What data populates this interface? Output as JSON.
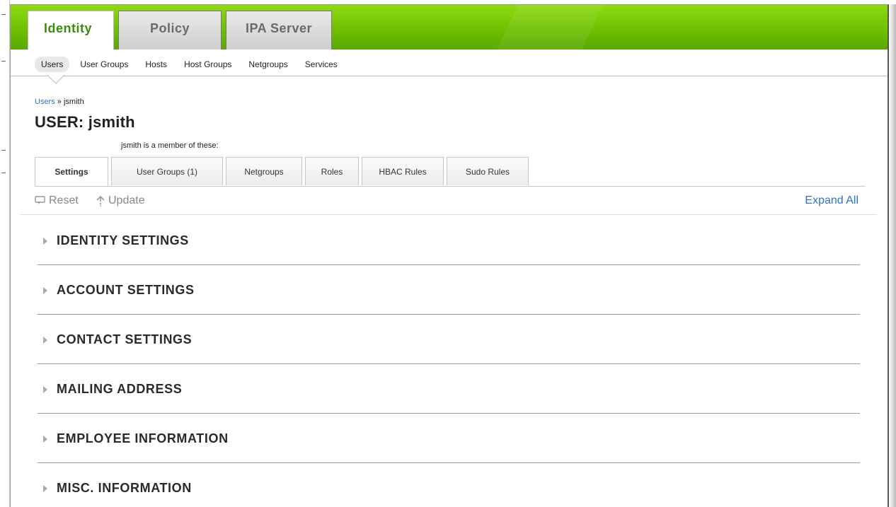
{
  "top_tabs": [
    {
      "label": "Identity",
      "active": true
    },
    {
      "label": "Policy",
      "active": false
    },
    {
      "label": "IPA Server",
      "active": false
    }
  ],
  "subnav": [
    {
      "label": "Users",
      "active": true
    },
    {
      "label": "User Groups",
      "active": false
    },
    {
      "label": "Hosts",
      "active": false
    },
    {
      "label": "Host Groups",
      "active": false
    },
    {
      "label": "Netgroups",
      "active": false
    },
    {
      "label": "Services",
      "active": false
    }
  ],
  "breadcrumb": {
    "link": "Users",
    "separator": " » ",
    "current": "jsmith"
  },
  "page_title": "USER: jsmith",
  "member_note": "jsmith is a member of these:",
  "facet_tabs": [
    {
      "label": "Settings",
      "active": true
    },
    {
      "label": "User Groups (1)",
      "active": false
    },
    {
      "label": "Netgroups",
      "active": false
    },
    {
      "label": "Roles",
      "active": false
    },
    {
      "label": "HBAC Rules",
      "active": false
    },
    {
      "label": "Sudo Rules",
      "active": false
    }
  ],
  "toolbar": {
    "reset_label": "Reset",
    "reset_icon": "reset-icon",
    "update_label": "Update",
    "update_icon": "update-arrow-icon",
    "expand_all_label": "Expand All"
  },
  "sections": [
    "IDENTITY SETTINGS",
    "ACCOUNT SETTINGS",
    "CONTACT SETTINGS",
    "MAILING ADDRESS",
    "EMPLOYEE INFORMATION",
    "MISC. INFORMATION"
  ],
  "colors": {
    "header_green": "#6fc000",
    "active_tab_text": "#3b8b10",
    "link_blue": "#2d73c6"
  }
}
